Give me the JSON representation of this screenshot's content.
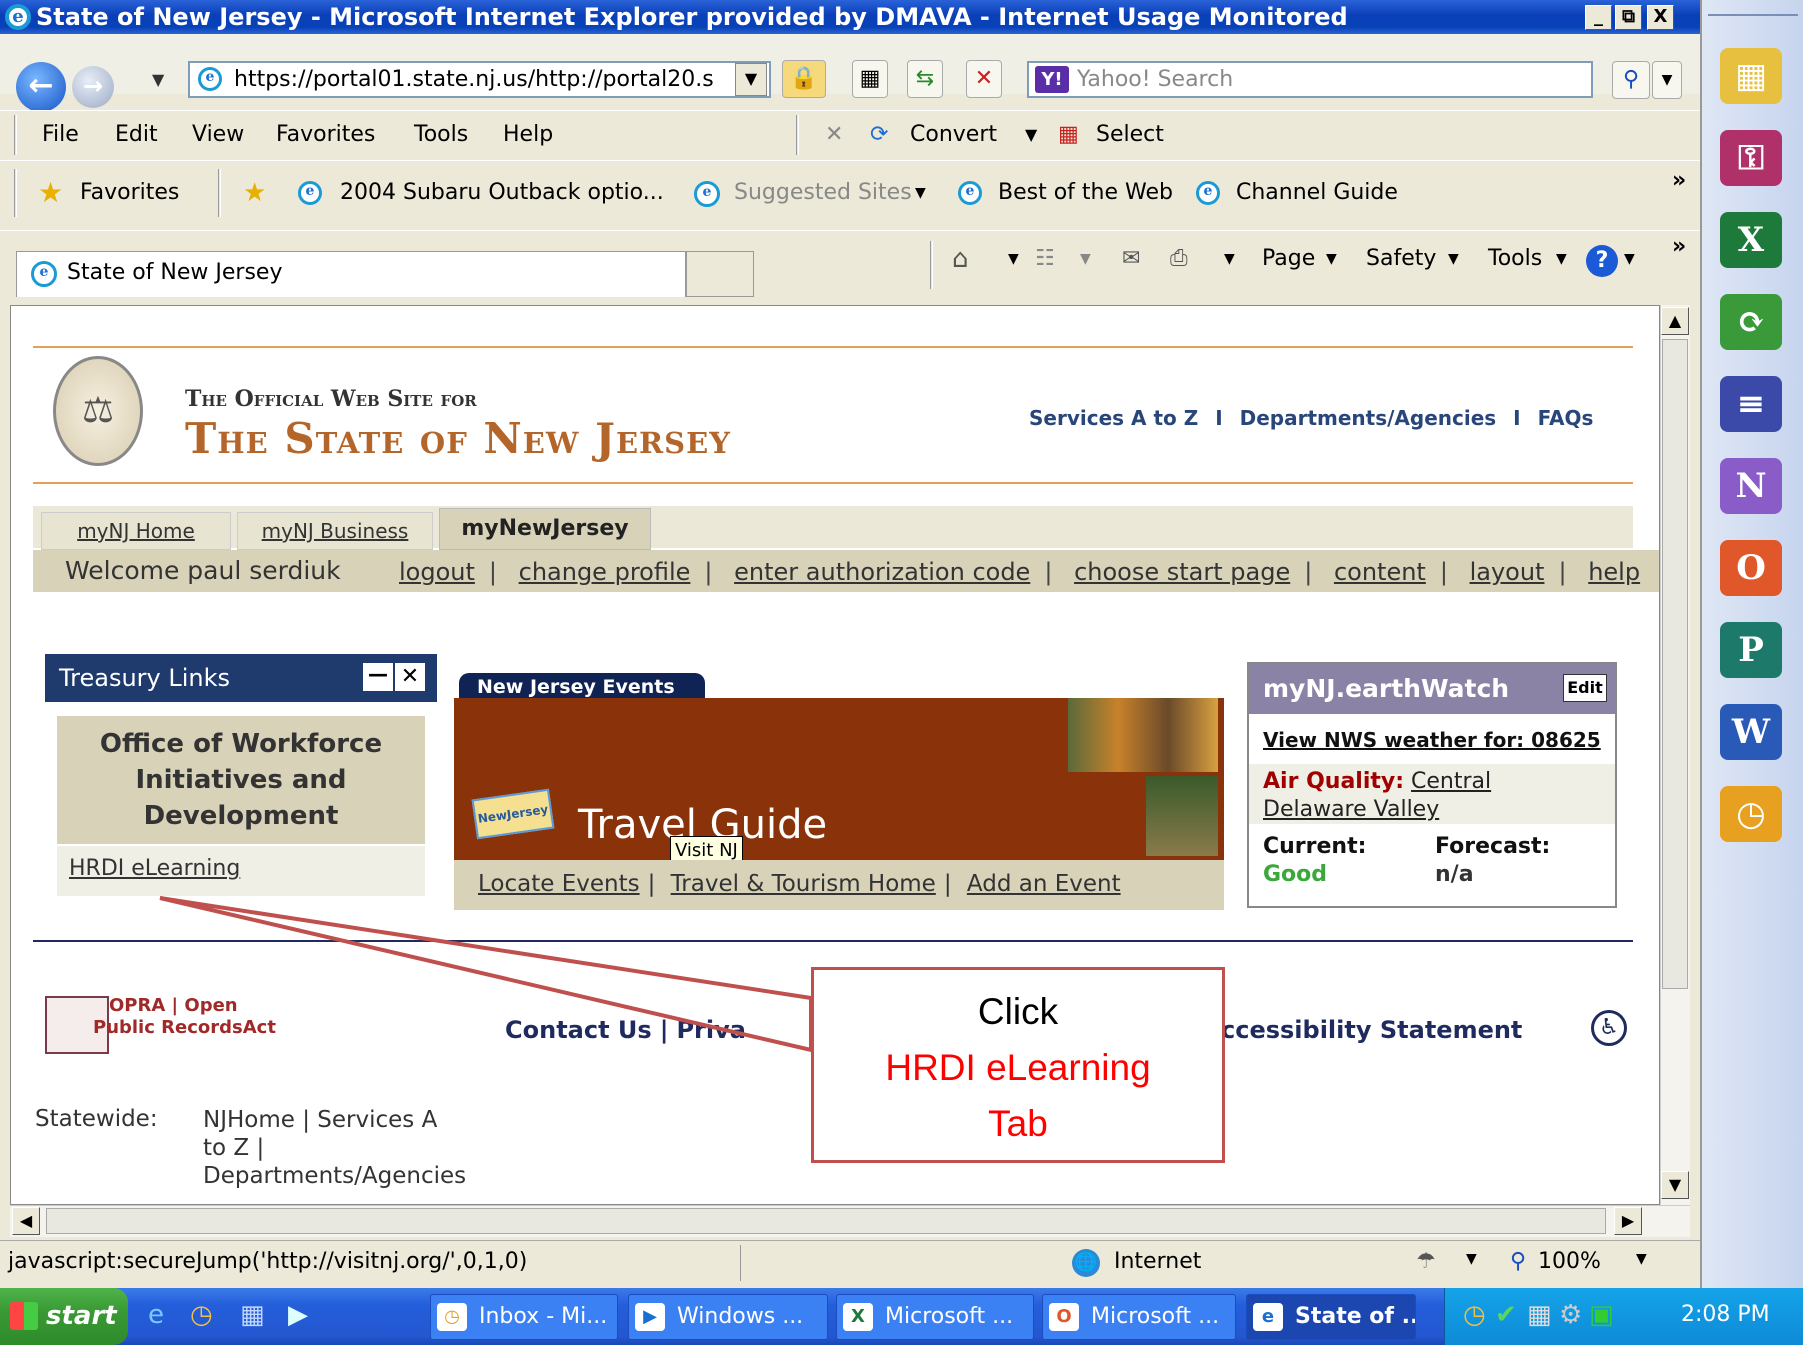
{
  "window": {
    "title": "State of New Jersey - Microsoft Internet Explorer provided by DMAVA - Internet Usage Monitored",
    "controls": [
      "_",
      "⧉",
      "X"
    ]
  },
  "navbar": {
    "address": "https://portal01.state.nj.us/http://portal20.s",
    "search_placeholder": "Yahoo! Search"
  },
  "menu": {
    "items": [
      "File",
      "Edit",
      "View",
      "Favorites",
      "Tools",
      "Help"
    ],
    "convert_label": "Convert",
    "select_label": "Select"
  },
  "favorites": {
    "favorites_label": "Favorites",
    "links": [
      "2004 Subaru Outback optio...",
      "Suggested Sites",
      "Best of the Web",
      "Channel Guide"
    ]
  },
  "tabs": {
    "active_tab": "State of New Jersey",
    "cmd_items": [
      "Page",
      "Safety",
      "Tools"
    ]
  },
  "page": {
    "site_title_small": "The Official Web Site for",
    "site_title_big": "The State of New Jersey",
    "top_links": [
      "Services A to Z",
      "Departments/Agencies",
      "FAQs"
    ],
    "mynj_tabs": [
      "myNJ Home",
      "myNJ Business",
      "myNewJersey"
    ],
    "welcome": "Welcome paul serdiuk",
    "user_links": [
      "logout",
      "change profile",
      "enter authorization code",
      "choose start page",
      "content",
      "layout",
      "help"
    ],
    "treasury": {
      "title": "Treasury Links",
      "section": "Office of Workforce Initiatives and Development",
      "link": "HRDI eLearning"
    },
    "events": {
      "tab_label": "New Jersey Events",
      "banner_text": "Travel Guide",
      "badge": "NewJersey",
      "tooltip": "Visit NJ",
      "links": [
        "Locate Events",
        "Travel & Tourism Home",
        "Add an Event"
      ]
    },
    "earthwatch": {
      "title": "myNJ.earthWatch",
      "edit": "Edit",
      "nws_link": "View NWS weather for: 08625",
      "air_quality_label": "Air Quality:",
      "air_quality_region": "Central Delaware Valley",
      "current_label": "Current:",
      "current_value": "Good",
      "forecast_label": "Forecast:",
      "forecast_value": "n/a"
    },
    "footer": {
      "opra_top": "OPRA | Open",
      "opra_bottom": "Public RecordsAct",
      "contact": "Contact Us",
      "privacy": "Priva",
      "accessibility": "ccessibility Statement",
      "statewide_label": "Statewide:",
      "statewide_links": [
        "NJHome",
        "Services A",
        "to Z",
        "Departments/Agencies"
      ]
    }
  },
  "callout": {
    "line1": "Click",
    "line2": "HRDI eLearning",
    "line3": "Tab",
    "highlight_color": "#ff0000",
    "border_color": "#c0504d"
  },
  "statusbar": {
    "url": "javascript:secureJump('http://visitnj.org/',0,1,0)",
    "zone": "Internet",
    "zoom": "100%"
  },
  "taskbar": {
    "start": "start",
    "tasks": [
      "Inbox - Mi...",
      "Windows ...",
      "Microsoft ...",
      "Microsoft ...",
      "State of ..."
    ],
    "clock": "2:08 PM"
  }
}
